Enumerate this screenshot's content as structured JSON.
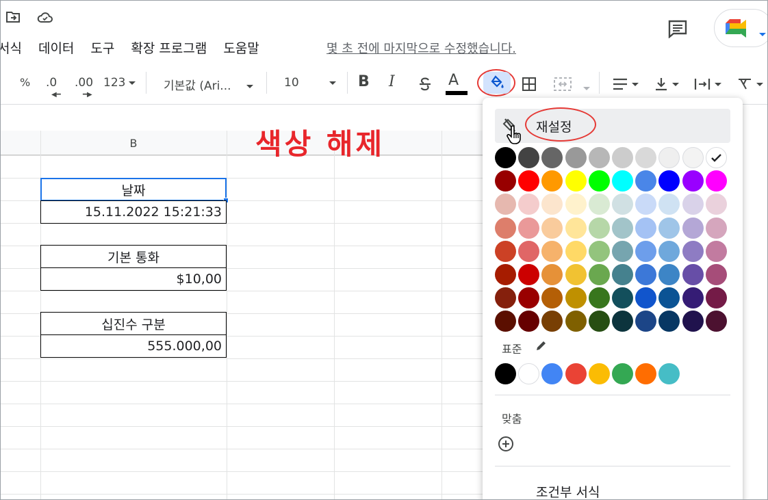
{
  "menubar": {
    "items": [
      "서식",
      "데이터",
      "도구",
      "확장 프로그램",
      "도움말"
    ],
    "last_edit": "몇 초 전에 마지막으로 수정했습니다."
  },
  "toolbar": {
    "percent": "%",
    "dec_decrease": ".0",
    "dec_increase": ".00",
    "more_formats": "123",
    "font": "기본값 (Ari...",
    "font_size": "10",
    "bold": "B",
    "italic": "I",
    "text_color": "A"
  },
  "grid": {
    "column_b": "B"
  },
  "cells": {
    "date_header": "날짜",
    "date_value": "15.11.2022 15:21:33",
    "currency_header": "기본 통화",
    "currency_value": "$10,00",
    "decimal_header": "십진수 구분",
    "decimal_value": "555.000,00"
  },
  "annotation": {
    "title": "색상 해제",
    "color": "#e8262b"
  },
  "fill_color_menu": {
    "reset_label": "재설정",
    "standard_label": "표준",
    "custom_label": "맞춤",
    "conditional_label": "조건부 서식",
    "palette": [
      [
        "#000000",
        "#434343",
        "#666666",
        "#999999",
        "#b7b7b7",
        "#cccccc",
        "#d9d9d9",
        "#efefef",
        "#f3f3f3",
        "#ffffff"
      ],
      [
        "#980000",
        "#ff0000",
        "#ff9900",
        "#ffff00",
        "#00ff00",
        "#00ffff",
        "#4a86e8",
        "#0000ff",
        "#9900ff",
        "#ff00ff"
      ],
      [
        "#e6b8af",
        "#f4cccc",
        "#fce5cd",
        "#fff2cc",
        "#d9ead3",
        "#d0e0e3",
        "#c9daf8",
        "#cfe2f3",
        "#d9d2e9",
        "#ead1dc"
      ],
      [
        "#dd7e6b",
        "#ea9999",
        "#f9cb9c",
        "#ffe599",
        "#b6d7a8",
        "#a2c4c9",
        "#a4c2f4",
        "#9fc5e8",
        "#b4a7d6",
        "#d5a6bd"
      ],
      [
        "#cc4125",
        "#e06666",
        "#f6b26b",
        "#ffd966",
        "#93c47d",
        "#76a5af",
        "#6d9eeb",
        "#6fa8dc",
        "#8e7cc3",
        "#c27ba0"
      ],
      [
        "#a61c00",
        "#cc0000",
        "#e69138",
        "#f1c232",
        "#6aa84f",
        "#45818e",
        "#3c78d8",
        "#3d85c6",
        "#674ea7",
        "#a64d79"
      ],
      [
        "#85200c",
        "#990000",
        "#b45f06",
        "#bf9000",
        "#38761d",
        "#134f5c",
        "#1155cc",
        "#0b5394",
        "#351c75",
        "#741b47"
      ],
      [
        "#5b0f00",
        "#660000",
        "#783f04",
        "#7f6000",
        "#274e13",
        "#0c343d",
        "#1c4587",
        "#073763",
        "#20124d",
        "#4c1130"
      ]
    ],
    "standard": [
      "#000000",
      "#ffffff",
      "#4285f4",
      "#ea4335",
      "#fbbc04",
      "#34a853",
      "#ff6d01",
      "#46bdc6"
    ]
  }
}
